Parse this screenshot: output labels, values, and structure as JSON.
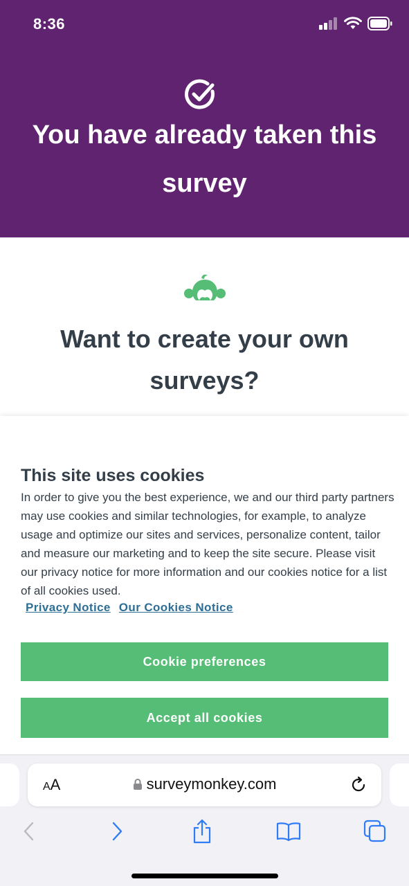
{
  "status_bar": {
    "time": "8:36",
    "icons": [
      "cellular-signal-icon",
      "wifi-icon",
      "battery-icon"
    ]
  },
  "header": {
    "icon": "check-circle-icon",
    "title": "You have already taken this survey",
    "background_color": "#5f2370"
  },
  "promo": {
    "logo": "surveymonkey-logo-icon",
    "title": "Want to create your own surveys?",
    "logo_color": "#55bd75"
  },
  "cookie_banner": {
    "title": "This site uses cookies",
    "text": "In order to give you the best experience, we and our third party partners may use cookies and similar technologies, for example, to analyze usage and optimize our sites and services, personalize content, tailor and measure our marketing and to keep the site secure. Please visit our privacy notice for more information and our cookies notice for a list of all cookies used.",
    "links": {
      "privacy": "Privacy Notice",
      "cookies": "Our Cookies Notice"
    },
    "buttons": {
      "preferences": "Cookie preferences",
      "accept": "Accept all cookies"
    },
    "button_color": "#55bd75",
    "link_color": "#2d6e96"
  },
  "safari": {
    "aa_label_small": "A",
    "aa_label_large": "A",
    "url": "surveymonkey.com",
    "toolbar_icons": [
      "back-icon",
      "forward-icon",
      "share-icon",
      "bookmarks-icon",
      "tabs-icon"
    ]
  }
}
